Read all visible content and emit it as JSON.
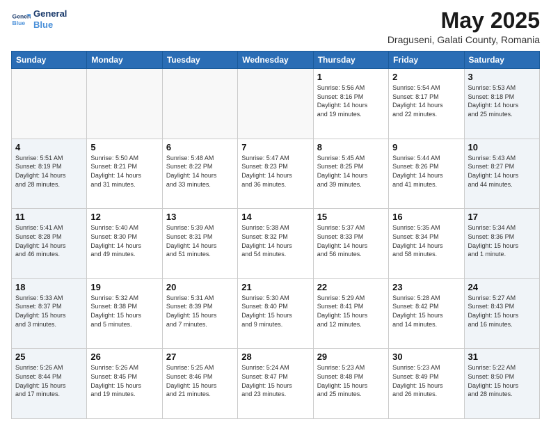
{
  "header": {
    "logo_line1": "General",
    "logo_line2": "Blue",
    "month_title": "May 2025",
    "location": "Draguseni, Galati County, Romania"
  },
  "weekdays": [
    "Sunday",
    "Monday",
    "Tuesday",
    "Wednesday",
    "Thursday",
    "Friday",
    "Saturday"
  ],
  "weeks": [
    [
      {
        "day": "",
        "info": ""
      },
      {
        "day": "",
        "info": ""
      },
      {
        "day": "",
        "info": ""
      },
      {
        "day": "",
        "info": ""
      },
      {
        "day": "1",
        "info": "Sunrise: 5:56 AM\nSunset: 8:16 PM\nDaylight: 14 hours\nand 19 minutes."
      },
      {
        "day": "2",
        "info": "Sunrise: 5:54 AM\nSunset: 8:17 PM\nDaylight: 14 hours\nand 22 minutes."
      },
      {
        "day": "3",
        "info": "Sunrise: 5:53 AM\nSunset: 8:18 PM\nDaylight: 14 hours\nand 25 minutes."
      }
    ],
    [
      {
        "day": "4",
        "info": "Sunrise: 5:51 AM\nSunset: 8:19 PM\nDaylight: 14 hours\nand 28 minutes."
      },
      {
        "day": "5",
        "info": "Sunrise: 5:50 AM\nSunset: 8:21 PM\nDaylight: 14 hours\nand 31 minutes."
      },
      {
        "day": "6",
        "info": "Sunrise: 5:48 AM\nSunset: 8:22 PM\nDaylight: 14 hours\nand 33 minutes."
      },
      {
        "day": "7",
        "info": "Sunrise: 5:47 AM\nSunset: 8:23 PM\nDaylight: 14 hours\nand 36 minutes."
      },
      {
        "day": "8",
        "info": "Sunrise: 5:45 AM\nSunset: 8:25 PM\nDaylight: 14 hours\nand 39 minutes."
      },
      {
        "day": "9",
        "info": "Sunrise: 5:44 AM\nSunset: 8:26 PM\nDaylight: 14 hours\nand 41 minutes."
      },
      {
        "day": "10",
        "info": "Sunrise: 5:43 AM\nSunset: 8:27 PM\nDaylight: 14 hours\nand 44 minutes."
      }
    ],
    [
      {
        "day": "11",
        "info": "Sunrise: 5:41 AM\nSunset: 8:28 PM\nDaylight: 14 hours\nand 46 minutes."
      },
      {
        "day": "12",
        "info": "Sunrise: 5:40 AM\nSunset: 8:30 PM\nDaylight: 14 hours\nand 49 minutes."
      },
      {
        "day": "13",
        "info": "Sunrise: 5:39 AM\nSunset: 8:31 PM\nDaylight: 14 hours\nand 51 minutes."
      },
      {
        "day": "14",
        "info": "Sunrise: 5:38 AM\nSunset: 8:32 PM\nDaylight: 14 hours\nand 54 minutes."
      },
      {
        "day": "15",
        "info": "Sunrise: 5:37 AM\nSunset: 8:33 PM\nDaylight: 14 hours\nand 56 minutes."
      },
      {
        "day": "16",
        "info": "Sunrise: 5:35 AM\nSunset: 8:34 PM\nDaylight: 14 hours\nand 58 minutes."
      },
      {
        "day": "17",
        "info": "Sunrise: 5:34 AM\nSunset: 8:36 PM\nDaylight: 15 hours\nand 1 minute."
      }
    ],
    [
      {
        "day": "18",
        "info": "Sunrise: 5:33 AM\nSunset: 8:37 PM\nDaylight: 15 hours\nand 3 minutes."
      },
      {
        "day": "19",
        "info": "Sunrise: 5:32 AM\nSunset: 8:38 PM\nDaylight: 15 hours\nand 5 minutes."
      },
      {
        "day": "20",
        "info": "Sunrise: 5:31 AM\nSunset: 8:39 PM\nDaylight: 15 hours\nand 7 minutes."
      },
      {
        "day": "21",
        "info": "Sunrise: 5:30 AM\nSunset: 8:40 PM\nDaylight: 15 hours\nand 9 minutes."
      },
      {
        "day": "22",
        "info": "Sunrise: 5:29 AM\nSunset: 8:41 PM\nDaylight: 15 hours\nand 12 minutes."
      },
      {
        "day": "23",
        "info": "Sunrise: 5:28 AM\nSunset: 8:42 PM\nDaylight: 15 hours\nand 14 minutes."
      },
      {
        "day": "24",
        "info": "Sunrise: 5:27 AM\nSunset: 8:43 PM\nDaylight: 15 hours\nand 16 minutes."
      }
    ],
    [
      {
        "day": "25",
        "info": "Sunrise: 5:26 AM\nSunset: 8:44 PM\nDaylight: 15 hours\nand 17 minutes."
      },
      {
        "day": "26",
        "info": "Sunrise: 5:26 AM\nSunset: 8:45 PM\nDaylight: 15 hours\nand 19 minutes."
      },
      {
        "day": "27",
        "info": "Sunrise: 5:25 AM\nSunset: 8:46 PM\nDaylight: 15 hours\nand 21 minutes."
      },
      {
        "day": "28",
        "info": "Sunrise: 5:24 AM\nSunset: 8:47 PM\nDaylight: 15 hours\nand 23 minutes."
      },
      {
        "day": "29",
        "info": "Sunrise: 5:23 AM\nSunset: 8:48 PM\nDaylight: 15 hours\nand 25 minutes."
      },
      {
        "day": "30",
        "info": "Sunrise: 5:23 AM\nSunset: 8:49 PM\nDaylight: 15 hours\nand 26 minutes."
      },
      {
        "day": "31",
        "info": "Sunrise: 5:22 AM\nSunset: 8:50 PM\nDaylight: 15 hours\nand 28 minutes."
      }
    ]
  ]
}
